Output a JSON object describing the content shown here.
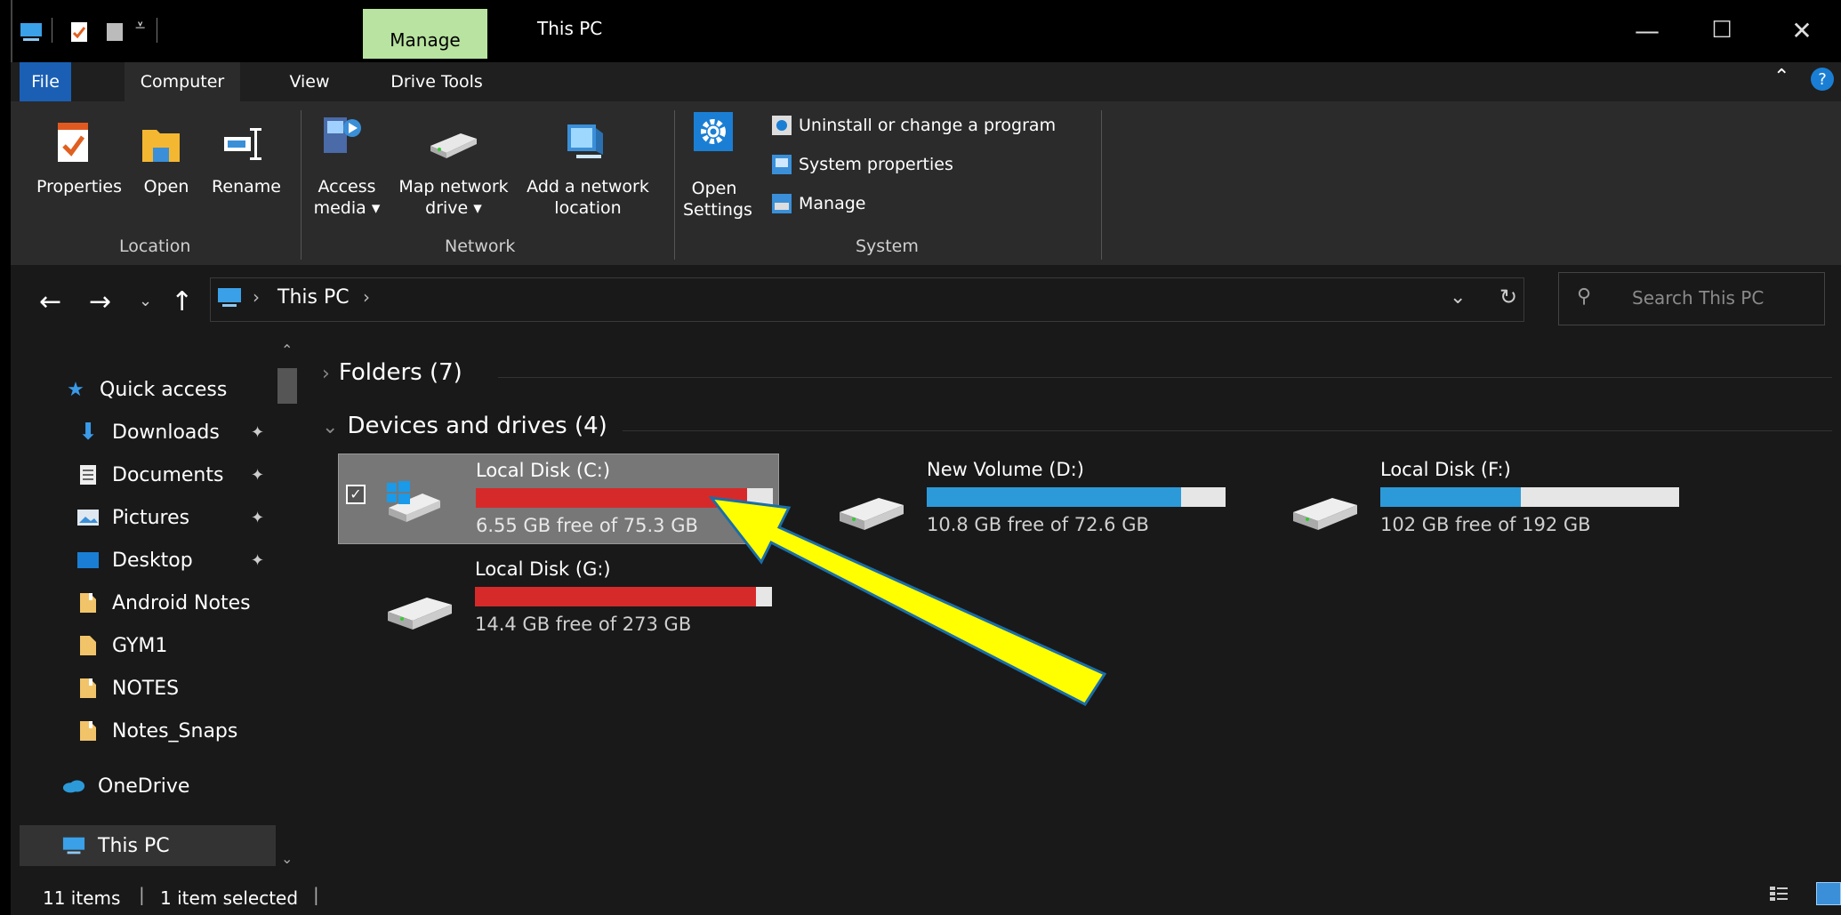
{
  "window": {
    "title": "This PC",
    "context_tab": "Manage",
    "controls": {
      "minimize": "—",
      "maximize": "☐",
      "close": "✕"
    }
  },
  "ribbon_tabs": {
    "file": "File",
    "computer": "Computer",
    "view": "View",
    "drive_tools": "Drive Tools"
  },
  "ribbon": {
    "location": {
      "label": "Location",
      "properties": "Properties",
      "open": "Open",
      "rename": "Rename"
    },
    "network": {
      "label": "Network",
      "access_media_1": "Access",
      "access_media_2": "media ▾",
      "map_drive_1": "Map network",
      "map_drive_2": "drive ▾",
      "add_location_1": "Add a network",
      "add_location_2": "location"
    },
    "system": {
      "label": "System",
      "open_settings_1": "Open",
      "open_settings_2": "Settings",
      "uninstall": "Uninstall or change a program",
      "system_properties": "System properties",
      "manage": "Manage"
    }
  },
  "address": {
    "breadcrumb": "This PC",
    "search_placeholder": "Search This PC"
  },
  "nav": {
    "quick_access": "Quick access",
    "items": [
      {
        "label": "Downloads"
      },
      {
        "label": "Documents"
      },
      {
        "label": "Pictures"
      },
      {
        "label": "Desktop"
      },
      {
        "label": "Android Notes"
      },
      {
        "label": "GYM1"
      },
      {
        "label": "NOTES"
      },
      {
        "label": "Notes_Snaps"
      }
    ],
    "onedrive": "OneDrive",
    "this_pc": "This PC"
  },
  "content": {
    "folders_header": "Folders (7)",
    "devices_header": "Devices and drives (4)",
    "drives": [
      {
        "name": "Local Disk (C:)",
        "info": "6.55 GB free of 75.3 GB",
        "used_fraction": 0.913,
        "color": "#d62a2a"
      },
      {
        "name": "New Volume (D:)",
        "info": "10.8 GB free of 72.6 GB",
        "used_fraction": 0.851,
        "color": "#2c9ad9"
      },
      {
        "name": "Local Disk (F:)",
        "info": "102 GB free of 192 GB",
        "used_fraction": 0.469,
        "color": "#2c9ad9"
      },
      {
        "name": "Local Disk (G:)",
        "info": "14.4 GB free of 273 GB",
        "used_fraction": 0.947,
        "color": "#d62a2a"
      }
    ]
  },
  "status": {
    "count": "11 items",
    "selected": "1 item selected"
  },
  "annotation": {
    "arrow_color": "#ffff00"
  }
}
